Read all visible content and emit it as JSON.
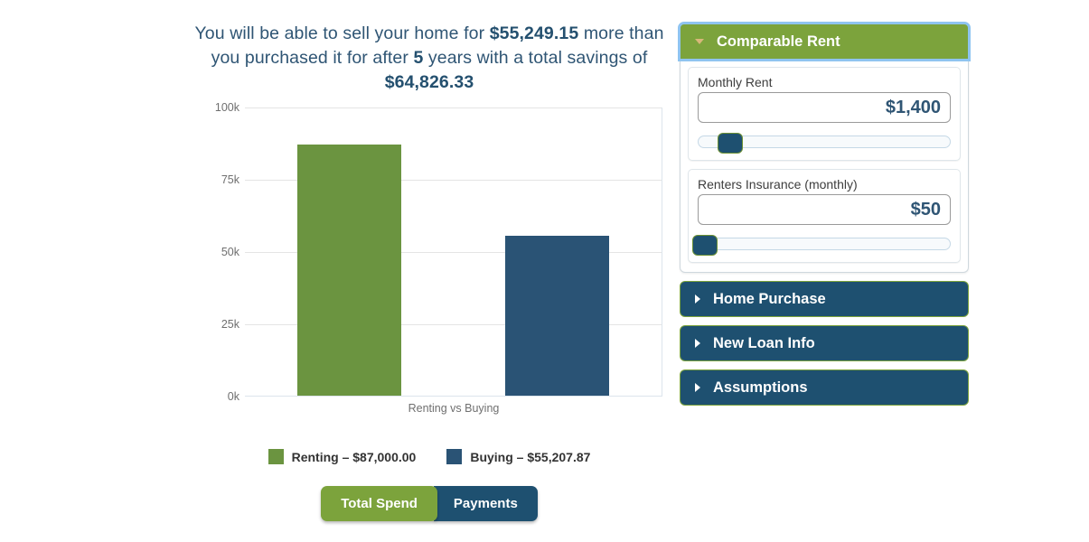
{
  "headline": {
    "part1": "You will be able to sell your home for ",
    "amount1": "$55,249.15",
    "part2": " more than you purchased it for after ",
    "years": "5",
    "part3": " years with a total savings of ",
    "amount2": "$64,826.33"
  },
  "chart_data": {
    "type": "bar",
    "title": "",
    "xlabel": "Renting vs Buying",
    "ylabel": "",
    "categories": [
      "Renting",
      "Buying"
    ],
    "values": [
      87000.0,
      55207.87
    ],
    "value_labels": [
      "$87,000.00",
      "$55,207.87"
    ],
    "colors": [
      "#6b9440",
      "#2a5375"
    ],
    "ylim": [
      0,
      100000
    ],
    "yticks": [
      0,
      25000,
      50000,
      75000,
      100000
    ],
    "ytick_labels": [
      "0k",
      "25k",
      "50k",
      "75k",
      "100k"
    ],
    "grid": true,
    "legend_position": "bottom",
    "legend": [
      {
        "label": "Renting – $87,000.00",
        "color": "#6b9440"
      },
      {
        "label": "Buying – $55,207.87",
        "color": "#2a5375"
      }
    ]
  },
  "toggle": {
    "total_spend": "Total Spend",
    "payments": "Payments",
    "active": "Total Spend"
  },
  "sidebar": {
    "sections": [
      {
        "title": "Comparable Rent",
        "state": "open",
        "fields": [
          {
            "label": "Monthly Rent",
            "value": "$1,400",
            "slider_percent": 13
          },
          {
            "label": "Renters Insurance (monthly)",
            "value": "$50",
            "slider_percent": 3
          }
        ]
      },
      {
        "title": "Home Purchase",
        "state": "closed"
      },
      {
        "title": "New Loan Info",
        "state": "closed"
      },
      {
        "title": "Assumptions",
        "state": "closed"
      }
    ]
  },
  "theme": {
    "green": "#7ca33c",
    "bar_green": "#6b9440",
    "navy": "#1e5070",
    "bar_navy": "#2a5375",
    "text_navy": "#2f5574",
    "focus_blue": "#8fc4f0"
  }
}
